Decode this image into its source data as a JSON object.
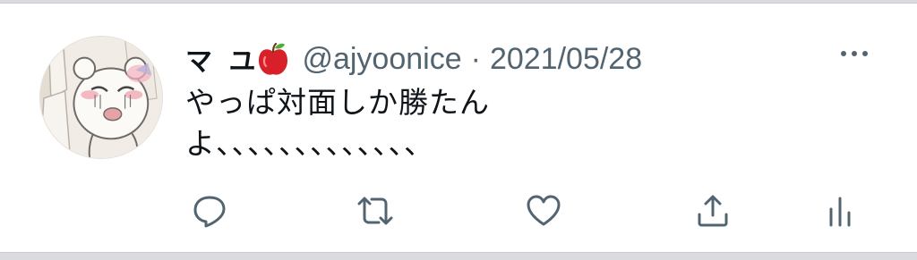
{
  "tweet": {
    "display_name": "マ ユ",
    "name_emoji_icon": "red-apple-icon",
    "handle": "@ajyoonice",
    "separator": "·",
    "date": "2021/05/28",
    "text_lines": [
      "やっぱ対面しか勝たん",
      "よ、、、、、、、、、、、、、"
    ]
  },
  "icons": {
    "more": "more-horizontal-icon",
    "reply": "reply-bubble-icon",
    "retweet": "retweet-icon",
    "like": "heart-icon",
    "share": "share-upload-icon",
    "analytics": "analytics-bars-icon"
  },
  "colors": {
    "text_primary": "#0f1419",
    "text_secondary": "#536471",
    "icon": "#536471",
    "apple": "#d8202a"
  }
}
